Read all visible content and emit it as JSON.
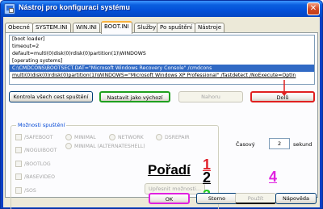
{
  "window": {
    "title": "Nástroj pro konfiguraci systému",
    "close_label": "✕"
  },
  "tabs": [
    {
      "label": "Obecné",
      "active": false
    },
    {
      "label": "SYSTEM.INI",
      "active": false
    },
    {
      "label": "WIN.INI",
      "active": false
    },
    {
      "label": "BOOT.INI",
      "active": true
    },
    {
      "label": "Služby",
      "active": false
    },
    {
      "label": "Po spuštění",
      "active": false
    },
    {
      "label": "Nástroje",
      "active": false
    }
  ],
  "boot_ini": {
    "lines": [
      "[boot loader]",
      "timeout=2",
      "default=multi(0)disk(0)rdisk(0)partition(1)\\WINDOWS",
      "[operating systems]",
      "C:\\CMDCONS\\BOOTSECT.DAT=\"Microsoft Windows Recovery Console\" /cmdcons",
      "multi(0)disk(0)rdisk(0)partition(1)\\WINDOWS=\"Microsoft Windows XP Professional\" /fastdetect /NoExecute=OptIn"
    ]
  },
  "buttons": {
    "check_paths": "Kontrola všech cest spuštění",
    "set_default": "Nastavit jako výchozí",
    "move_up": "Nahoru",
    "move_down": "Dolů",
    "advanced": "Upřesnit možnosti...",
    "ok": "OK",
    "cancel": "Storno",
    "apply": "Použít",
    "help": "Nápověda"
  },
  "boot_options": {
    "group_title": "Možnosti spuštění",
    "safeboot": "/SAFEBOOT",
    "minimal": "MINIMAL",
    "network": "NETWORK",
    "dsrepair": "DSREPAIR",
    "minimal_alt": "MINIMAL (ALTERNATESHELL)",
    "noguiboot": "/NOGUIBOOT",
    "bootlog": "/BOOTLOG",
    "basevideo": "/BASEVIDEO",
    "sos": "/SOS"
  },
  "timeout": {
    "label": "Časový",
    "value": "2",
    "unit": "sekund"
  },
  "annotations": {
    "heading": "Pořadí",
    "n1": "1",
    "n2": "2",
    "n3": "3",
    "n4": "4",
    "colors": {
      "n1": "#e0202a",
      "n2": "#000000",
      "n3": "#22cc22",
      "n4": "#e020e0",
      "outline_red": "#e02020",
      "outline_green": "#1fa01f",
      "outline_magenta": "#e020e0"
    }
  }
}
